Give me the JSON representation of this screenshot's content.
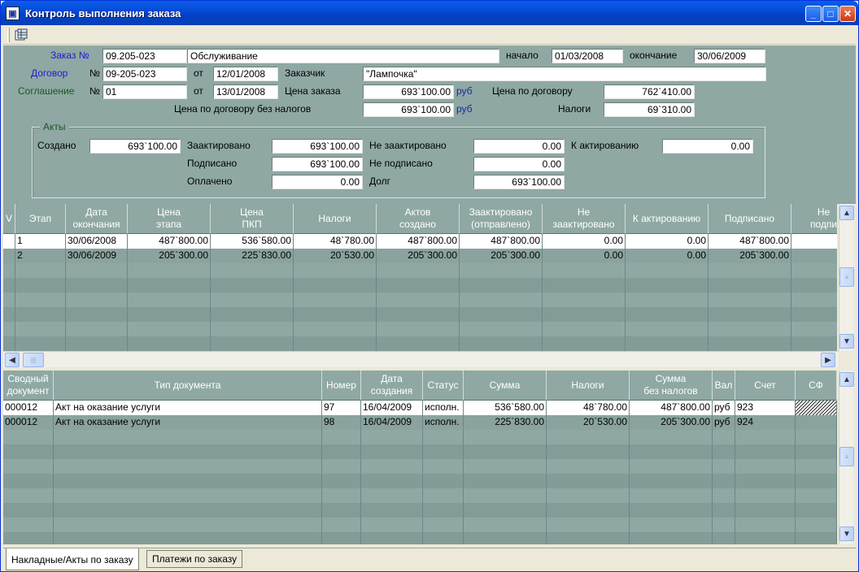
{
  "window": {
    "title": "Контроль выполнения заказа",
    "min_label": "_",
    "max_label": "□",
    "close_label": "✕"
  },
  "toolbar": {
    "icon": "grid-icon"
  },
  "order": {
    "order_label": "Заказ №",
    "order_number": "09.205-023",
    "order_name": "Обслуживание",
    "start_label": "начало",
    "start_date": "01/03/2008",
    "end_label": "окончание",
    "end_date": "30/06/2009",
    "contract_label": "Договор",
    "no_label": "№",
    "contract_number": "09-205-023",
    "from_label": "от",
    "contract_date": "12/01/2008",
    "customer_label": "Заказчик",
    "customer": "\"Лампочка\"",
    "agreement_label": "Соглашение",
    "agreement_number": "01",
    "agreement_date": "13/01/2008",
    "order_price_label": "Цена заказа",
    "order_price": "693`100.00",
    "currency": "руб",
    "contract_price_label": "Цена по договору",
    "contract_price": "762`410.00",
    "contract_price_notax_label": "Цена по договору без налогов",
    "contract_price_notax": "693`100.00",
    "taxes_label": "Налоги",
    "taxes": "69`310.00"
  },
  "acts": {
    "group_title": "Акты",
    "created_label": "Создано",
    "created": "693`100.00",
    "activated_label": "Заактировано",
    "activated": "693`100.00",
    "not_activated_label": "Не заактировано",
    "not_activated": "0.00",
    "to_activate_label": "К актированию",
    "to_activate": "0.00",
    "signed_label": "Подписано",
    "signed": "693`100.00",
    "not_signed_label": "Не подписано",
    "not_signed": "0.00",
    "paid_label": "Оплачено",
    "paid": "0.00",
    "debt_label": "Долг",
    "debt": "693`100.00"
  },
  "stages": {
    "headers": [
      "V",
      "Этап",
      "Дата\nокончания",
      "Цена\nэтапа",
      "Цена\nПКП",
      "Налоги",
      "Актов\nсоздано",
      "Заактировано\n(отправлено)",
      "Не\nзаактировано",
      "К актированию",
      "Подписано",
      "Не\nподпи"
    ],
    "rows": [
      [
        "",
        "1",
        "30/06/2008",
        "487`800.00",
        "536`580.00",
        "48`780.00",
        "487`800.00",
        "487`800.00",
        "0.00",
        "0.00",
        "487`800.00",
        ""
      ],
      [
        "",
        "2",
        "30/06/2009",
        "205`300.00",
        "225`830.00",
        "20`530.00",
        "205`300.00",
        "205`300.00",
        "0.00",
        "0.00",
        "205`300.00",
        ""
      ]
    ]
  },
  "docs": {
    "headers": [
      "Сводный\nдокумент",
      "Тип документа",
      "Номер",
      "Дата\nсоздания",
      "Статус",
      "Сумма",
      "Налоги",
      "Сумма\nбез налогов",
      "Вал",
      "Счет",
      "СФ"
    ],
    "rows": [
      [
        "000012",
        "Акт на оказание услуги",
        "97",
        "16/04/2009",
        "исполн.",
        "536`580.00",
        "48`780.00",
        "487`800.00",
        "руб",
        "923",
        ""
      ],
      [
        "000012",
        "Акт на оказание услуги",
        "98",
        "16/04/2009",
        "исполн.",
        "225`830.00",
        "20`530.00",
        "205`300.00",
        "руб",
        "924",
        ""
      ]
    ]
  },
  "tabs": [
    "Накладные/Акты по заказу",
    "Платежи по заказу"
  ]
}
